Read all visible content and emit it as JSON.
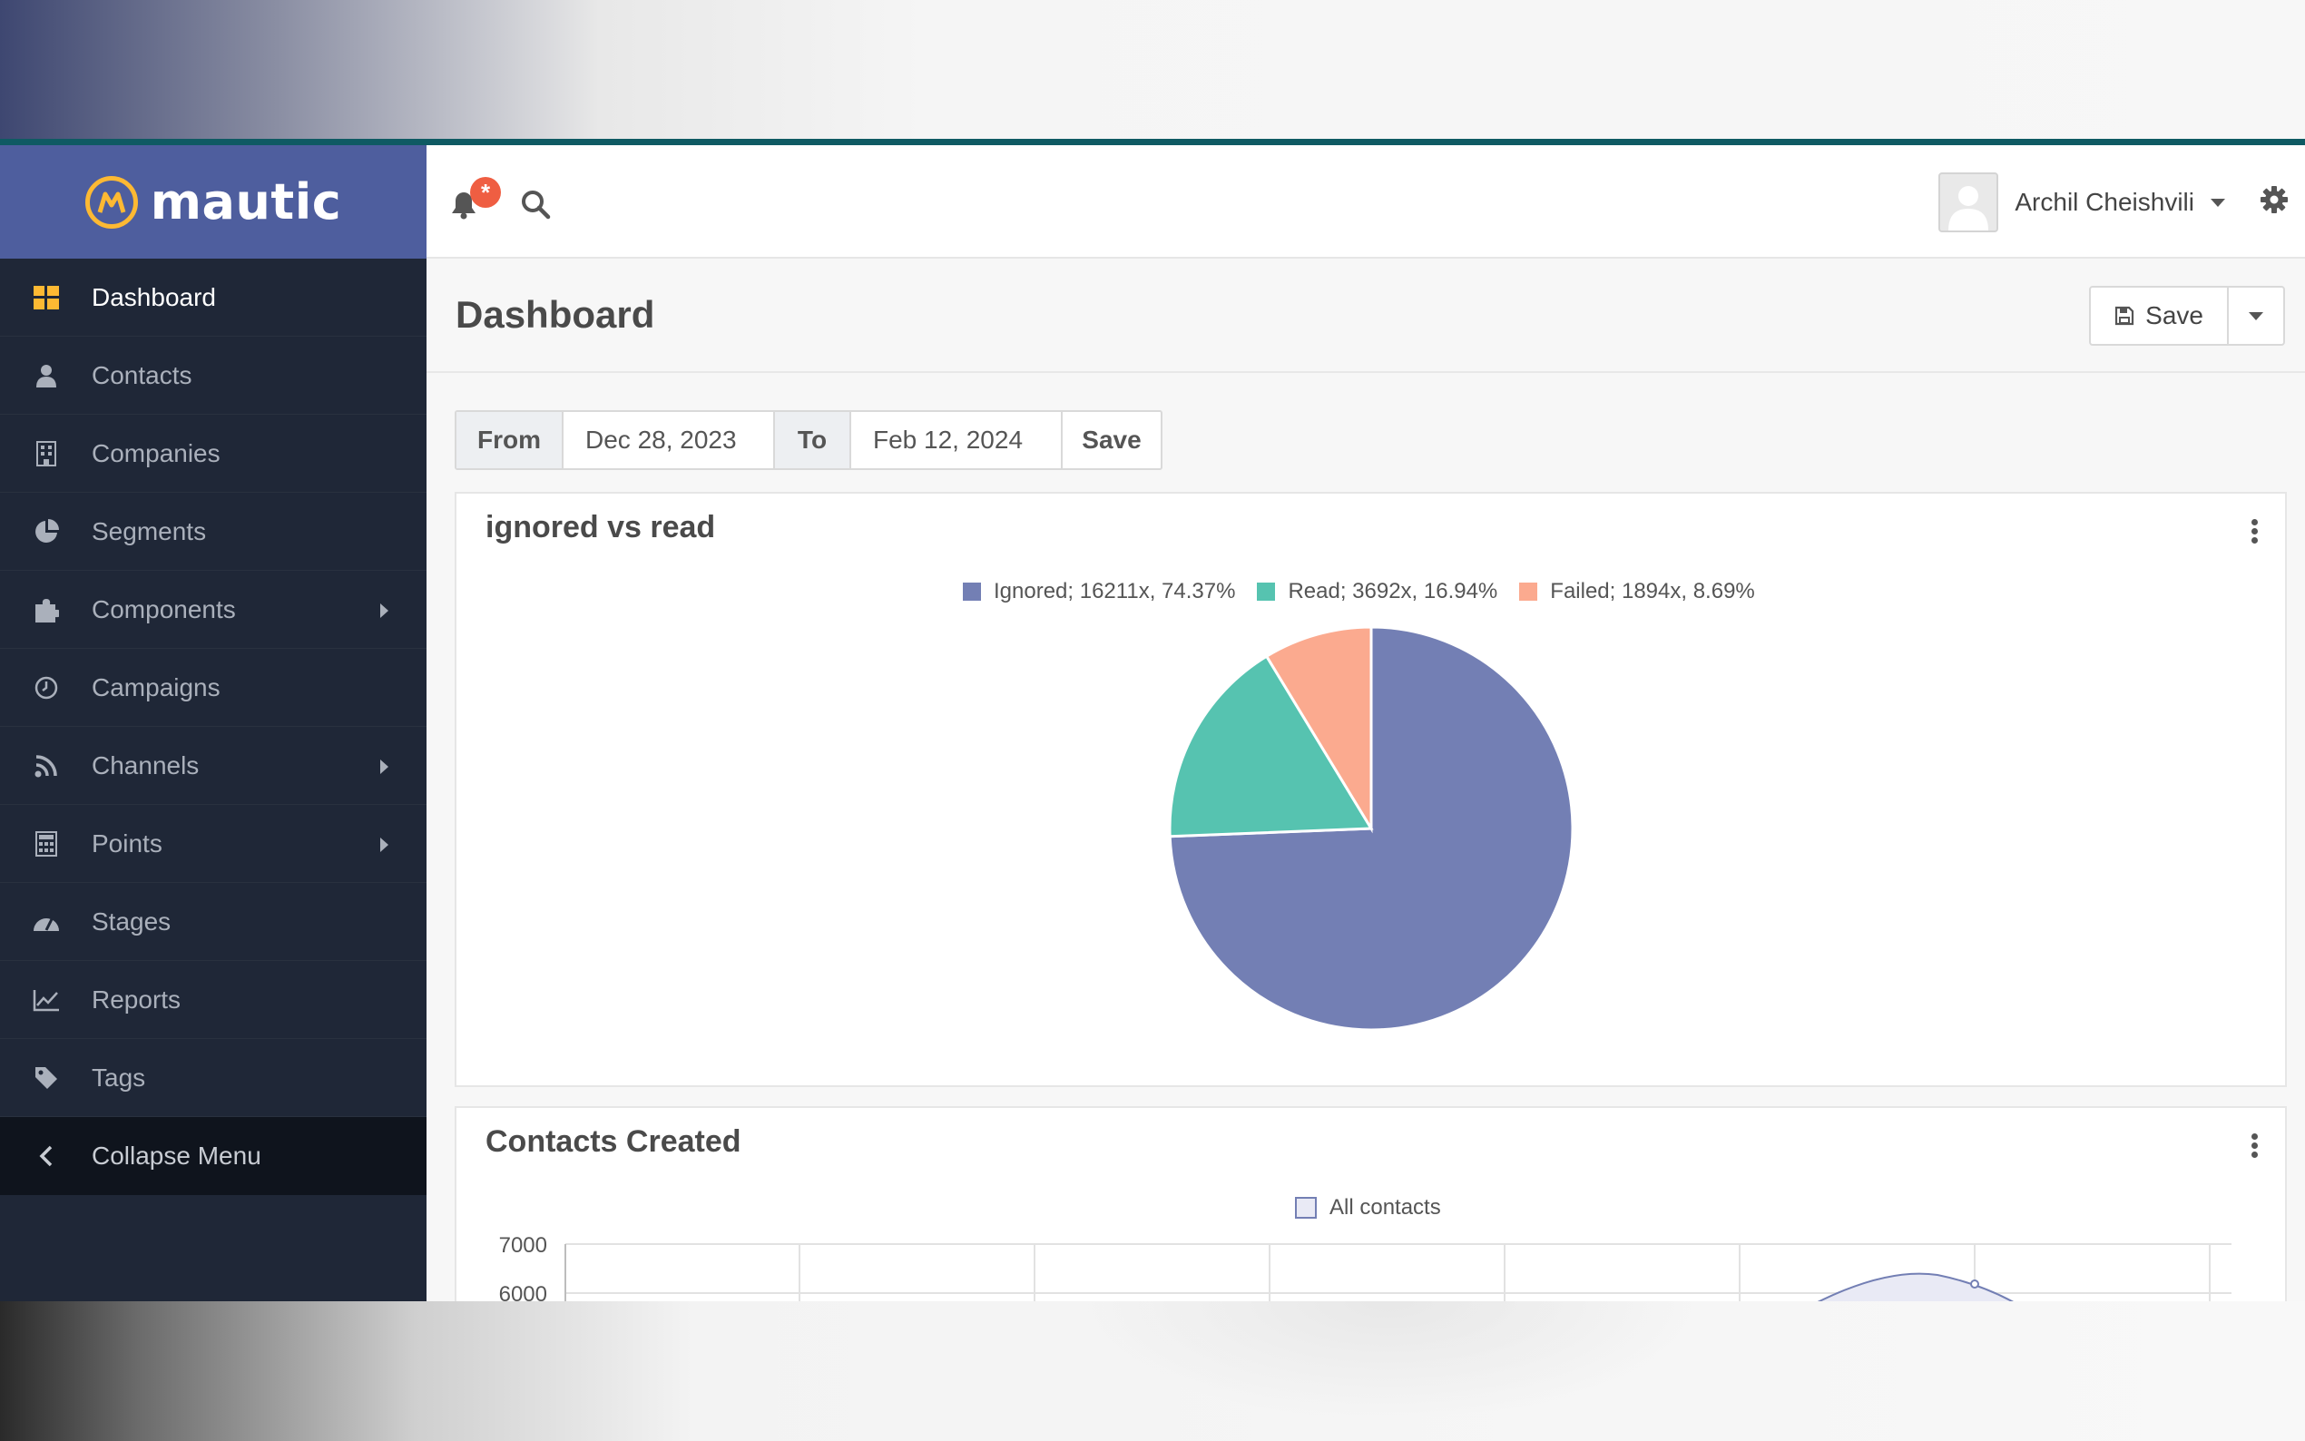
{
  "brand": {
    "name": "mautic"
  },
  "sidebar": {
    "items": [
      {
        "label": "Dashboard",
        "icon": "dashboard-icon",
        "active": true
      },
      {
        "label": "Contacts",
        "icon": "user-icon"
      },
      {
        "label": "Companies",
        "icon": "building-icon"
      },
      {
        "label": "Segments",
        "icon": "pie-chart-icon"
      },
      {
        "label": "Components",
        "icon": "puzzle-icon",
        "submenu": true
      },
      {
        "label": "Campaigns",
        "icon": "clock-icon"
      },
      {
        "label": "Channels",
        "icon": "rss-icon",
        "submenu": true
      },
      {
        "label": "Points",
        "icon": "calculator-icon",
        "submenu": true
      },
      {
        "label": "Stages",
        "icon": "tachometer-icon"
      },
      {
        "label": "Reports",
        "icon": "line-chart-icon"
      },
      {
        "label": "Tags",
        "icon": "tag-icon"
      }
    ],
    "collapse_label": "Collapse Menu"
  },
  "header": {
    "notification_badge": "*",
    "user_name": "Archil Cheishvili"
  },
  "page": {
    "title": "Dashboard",
    "save_label": "Save"
  },
  "filter": {
    "from_label": "From",
    "from_value": "Dec 28, 2023",
    "to_label": "To",
    "to_value": "Feb 12, 2024",
    "save_label": "Save"
  },
  "widgets": {
    "pie": {
      "title": "ignored vs read"
    },
    "line": {
      "title": "Contacts Created"
    }
  },
  "colors": {
    "ignored": "#737fb4",
    "read": "#56c3b0",
    "failed": "#fbaa8f",
    "brand": "#4e5e9e",
    "accent": "#fdb933"
  },
  "chart_data": [
    {
      "type": "pie",
      "title": "ignored vs read",
      "slices": [
        {
          "label": "Ignored; 16211x, 74.37%",
          "value": 16211,
          "percent": 74.37
        },
        {
          "label": "Read; 3692x, 16.94%",
          "value": 3692,
          "percent": 16.94
        },
        {
          "label": "Failed; 1894x, 8.69%",
          "value": 1894,
          "percent": 8.69
        }
      ]
    },
    {
      "type": "line",
      "title": "Contacts Created",
      "series": [
        {
          "name": "All contacts"
        }
      ],
      "y_ticks": [
        "7000",
        "6000"
      ]
    }
  ]
}
